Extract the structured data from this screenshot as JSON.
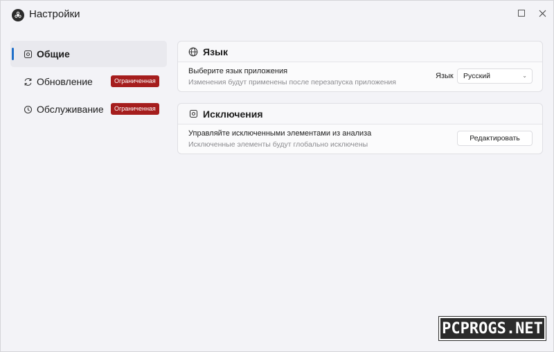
{
  "window": {
    "title": "Настройки",
    "app_icon": "biohazard-icon"
  },
  "sidebar": {
    "items": [
      {
        "label": "Общие",
        "icon": "gear-icon",
        "active": true,
        "badge": ""
      },
      {
        "label": "Обновление",
        "icon": "refresh-icon",
        "active": false,
        "badge": "Ограниченная"
      },
      {
        "label": "Обслуживание",
        "icon": "clock-icon",
        "active": false,
        "badge": "Ограниченная"
      }
    ]
  },
  "language_card": {
    "title": "Язык",
    "icon": "globe-icon",
    "row_title": "Выберите язык приложения",
    "row_subtitle": "Изменения будут применены после перезапуска приложения",
    "field_label": "Язык",
    "selected_language": "Русский"
  },
  "exclusions_card": {
    "title": "Исключения",
    "icon": "gear-icon",
    "row_title": "Управляйте исключенными элементами из анализа",
    "row_subtitle": "Исключенные элементы будут глобально исключены",
    "button_label": "Редактировать"
  },
  "watermark": "PCPROGS.NET",
  "colors": {
    "accent": "#1f6fc9",
    "badge": "#a51d1d",
    "background": "#f3f3f7"
  }
}
